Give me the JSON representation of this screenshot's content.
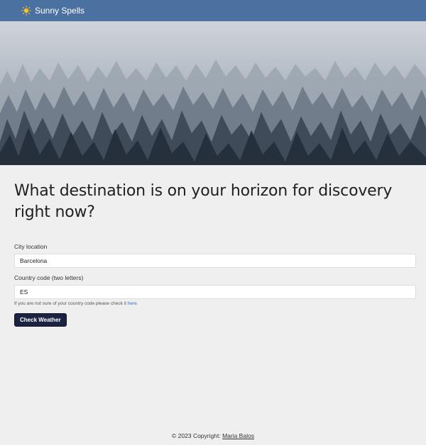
{
  "navbar": {
    "brand": "Sunny Spells",
    "brand_icon": "sun-icon",
    "background": "#4a71a0"
  },
  "hero": {
    "image": "misty-pine-forest"
  },
  "form": {
    "heading": "What destination is on your horizon for discovery right now?",
    "city_label": "City location",
    "city_value": "Barcelona",
    "country_label": "Country code (two letters)",
    "country_value": "ES",
    "help_text": "If you are not sure of your country code please check it",
    "help_link": "here",
    "help_end": ".",
    "submit_label": "Check Weather",
    "button_color": "#1c2342"
  },
  "footer": {
    "copyright": "© 2023 Copyright:",
    "author": "Maria Balos"
  }
}
